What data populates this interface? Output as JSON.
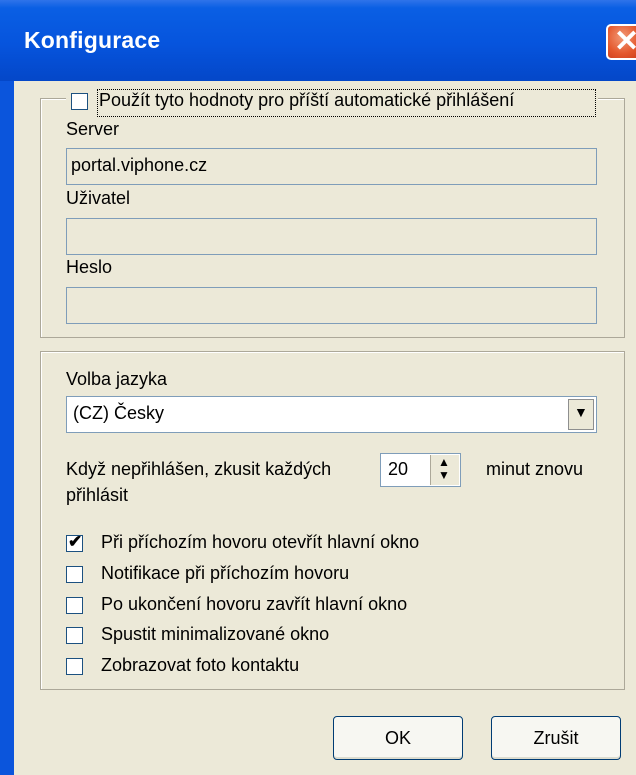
{
  "window": {
    "title": "Konfigurace",
    "close_glyph": "✕"
  },
  "login": {
    "remember_label": "Použít tyto hodnoty pro příští automatické přihlášení",
    "remember_checked": false,
    "server_label": "Server",
    "server_value": "portal.viphone.cz",
    "user_label": "Uživatel",
    "user_value": "",
    "password_label": "Heslo",
    "password_value": ""
  },
  "settings": {
    "language_label": "Volba jazyka",
    "language_value": "(CZ) Česky",
    "retry_prefix": "Když nepřihlášen, zkusit každých",
    "retry_value": "20",
    "retry_suffix": "minut znovu",
    "retry_suffix2": "přihlásit",
    "options": [
      {
        "label": "Při příchozím hovoru otevřít hlavní okno",
        "checked": true
      },
      {
        "label": "Notifikace při příchozím hovoru",
        "checked": false
      },
      {
        "label": "Po ukončení hovoru zavřít hlavní okno",
        "checked": false
      },
      {
        "label": "Spustit minimalizované okno",
        "checked": false
      },
      {
        "label": "Zobrazovat foto kontaktu",
        "checked": false
      }
    ]
  },
  "buttons": {
    "ok": "OK",
    "cancel": "Zrušit"
  },
  "colors": {
    "titlebar": "#0654dd",
    "face": "#ece9d8",
    "border": "#7f9db9"
  }
}
